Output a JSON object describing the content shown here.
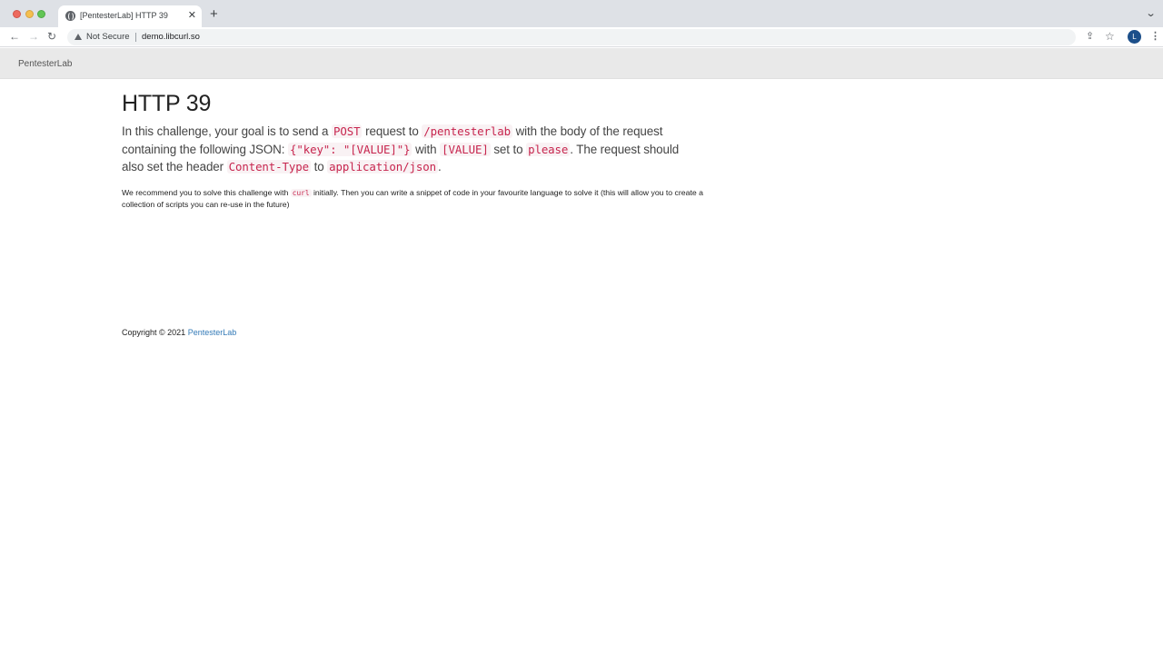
{
  "browser": {
    "tab": {
      "title": "[PentesterLab] HTTP 39",
      "close": "✕"
    },
    "new_tab": "+",
    "tab_overflow": "⌄",
    "omnibox": {
      "security_label": "Not Secure",
      "url": "demo.libcurl.so"
    },
    "profile_initial": "L",
    "icons": {
      "back": "←",
      "forward": "→",
      "reload": "↻",
      "share": "⇪",
      "star": "☆",
      "menu": "⋮"
    }
  },
  "navbar": {
    "brand": "PentesterLab"
  },
  "main": {
    "title": "HTTP 39",
    "lead": {
      "t1": "In this challenge, your goal is to send a",
      "c1": "POST",
      "t2": "request to",
      "c2": "/pentesterlab",
      "t3": "with the body of the request containing the following JSON:",
      "c3": "{\"key\": \"[VALUE]\"}",
      "t4": "with",
      "c4": "[VALUE]",
      "t5": "set to",
      "c5": "please",
      "t6": ". The request should also set the header",
      "c6": "Content-Type",
      "t7": "to",
      "c7": "application/json",
      "t8": "."
    },
    "note": {
      "t1": "We recommend you to solve this challenge with",
      "c1": "curl",
      "t2": "initially. Then you can write a snippet of code in your favourite language to solve it (this will allow you to create a collection of scripts you can re-use in the future)"
    }
  },
  "footer": {
    "copyright": "Copyright © 2021",
    "link": "PentesterLab"
  },
  "colors": {
    "code_text": "#c7254e",
    "code_bg": "#f9f2f4",
    "link": "#337ab7",
    "navbar_bg": "#e9e9e9"
  }
}
